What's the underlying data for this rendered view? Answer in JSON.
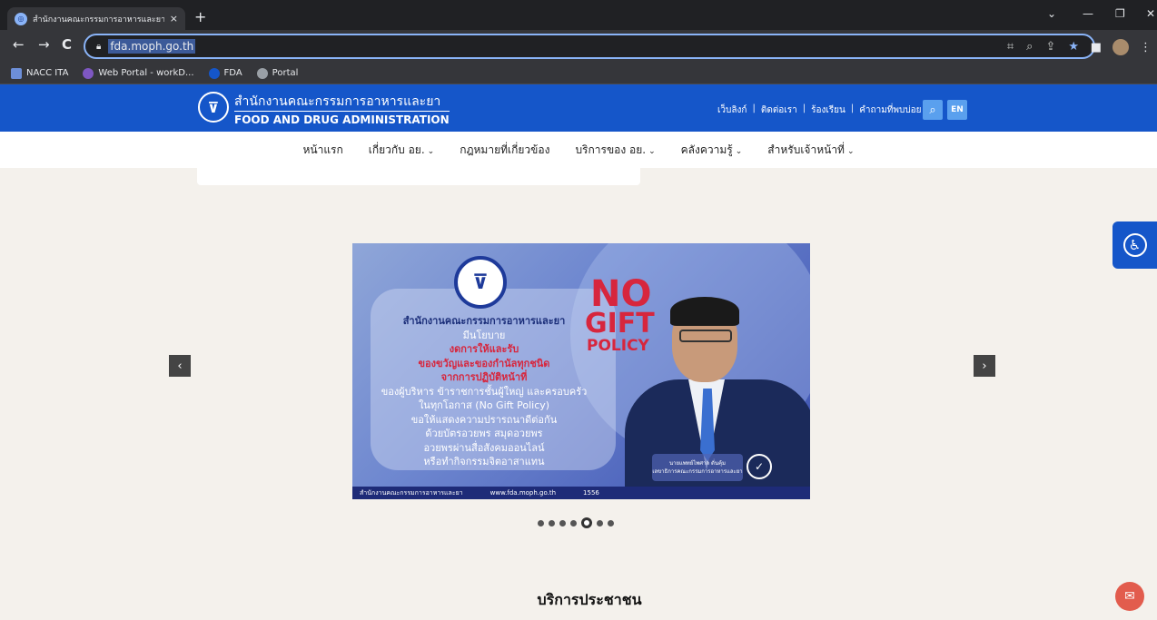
{
  "browser": {
    "tab_title": "สำนักงานคณะกรรมการอาหารและยา",
    "tab_close": "×",
    "new_tab": "+",
    "url": "fda.moph.go.th",
    "bookmarks": [
      {
        "label": "NACC ITA",
        "color": "#6d8fd8"
      },
      {
        "label": "Web Portal - workD...",
        "color": "#7e57c2"
      },
      {
        "label": "FDA",
        "color": "#1556c9"
      },
      {
        "label": "Portal",
        "color": "#9aa0a6"
      }
    ]
  },
  "header": {
    "org_name_th": "สำนักงานคณะกรรมการอาหารและยา",
    "org_name_en": "FOOD AND DRUG ADMINISTRATION",
    "top_links": [
      "เว็บลิงก์",
      "ติดต่อเรา",
      "ร้องเรียน",
      "คำถามที่พบบ่อย"
    ],
    "lang_button": "EN",
    "color": "#1556c9"
  },
  "nav": {
    "items": [
      {
        "label": "หน้าแรก",
        "dropdown": false
      },
      {
        "label": "เกี่ยวกับ อย.",
        "dropdown": true
      },
      {
        "label": "กฎหมายที่เกี่ยวข้อง",
        "dropdown": false
      },
      {
        "label": "บริการของ อย.",
        "dropdown": true
      },
      {
        "label": "คลังความรู้",
        "dropdown": true
      },
      {
        "label": "สำหรับเจ้าหน้าที่",
        "dropdown": true
      }
    ]
  },
  "carousel": {
    "slide": {
      "no": "NO",
      "gift": "GIFT",
      "policy": "POLICY",
      "lines": [
        "สำนักงานคณะกรรมการอาหารและยา",
        "มีนโยบาย",
        "งดการให้และรับ",
        "ของขวัญและของกำนัลทุกชนิด",
        "จากการปฏิบัติหน้าที่",
        "ของผู้บริหาร ข้าราชการชั้นผู้ใหญ่ และครอบครัว",
        "ในทุกโอกาส (No Gift Policy)",
        "ขอให้แสดงความปรารถนาดีต่อกัน",
        "ด้วยบัตรอวยพร สมุดอวยพร",
        "อวยพรผ่านสื่อสังคมออนไลน์",
        "หรือทำกิจกรรมจิตอาสาแทน"
      ],
      "name_plate": [
        "นายแพทย์ไพศาล ดั่นคุ้ม",
        "เลขาธิการคณะกรรมการอาหารและยา"
      ],
      "footer": [
        "สำนักงานคณะกรรมการอาหารและยา",
        "www.fda.moph.go.th",
        "1556"
      ]
    },
    "total_slides": 7,
    "active_slide": 5
  },
  "section": {
    "title": "บริการประชาชน"
  }
}
